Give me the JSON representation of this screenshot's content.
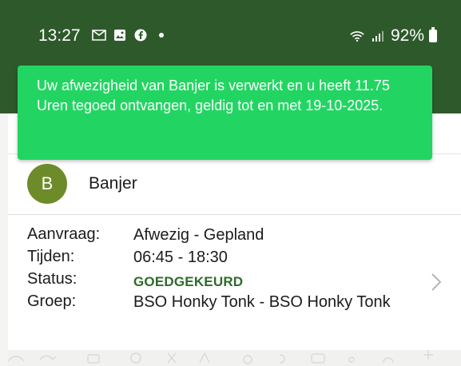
{
  "statusbar": {
    "time": "13:27",
    "icons": [
      "gmail-icon",
      "gallery-icon",
      "facebook-icon",
      "dot-icon"
    ],
    "battery": "92%"
  },
  "toast": {
    "message": "Uw afwezigheid van Banjer is verwerkt en u heeft 11.75 Uren tegoed ontvangen, geldig tot en met 19-10-2025."
  },
  "child": {
    "initial": "B",
    "name": "Banjer"
  },
  "details": {
    "labels": {
      "request": "Aanvraag:",
      "times": "Tijden:",
      "status": "Status:",
      "group": "Groep:"
    },
    "values": {
      "request": "Afwezig - Gepland",
      "times": "06:45 - 18:30",
      "status": "GOEDGEKEURD",
      "group": "BSO Honky Tonk - BSO Honky Tonk"
    }
  },
  "colors": {
    "header": "#2e5a2b",
    "toast": "#22d562",
    "status_approved": "#2e6b2a",
    "avatar": "#6e8b2a"
  }
}
